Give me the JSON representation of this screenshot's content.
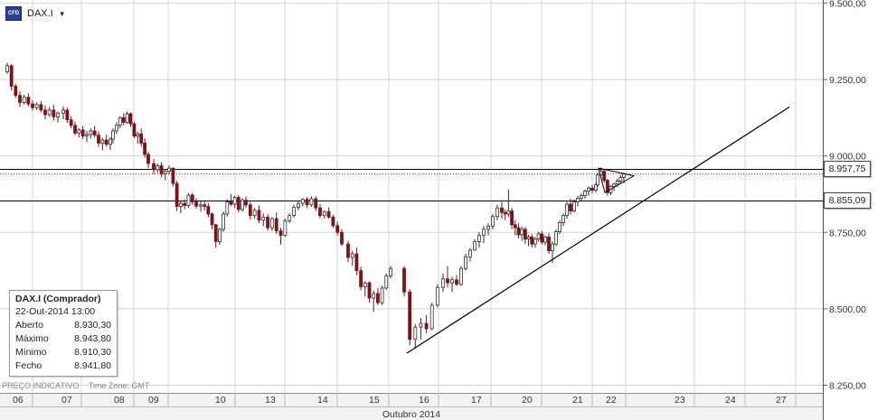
{
  "symbol": {
    "icon": "cfd-icon",
    "icon_text": "CFD",
    "name": "DAX.I"
  },
  "ohlc": {
    "title": "DAX.I (Comprador)",
    "datetime": "22-Out-2014 13:00",
    "rows": [
      {
        "label": "Aberto",
        "value": "8.930,30"
      },
      {
        "label": "Máximo",
        "value": "8.943,80"
      },
      {
        "label": "Mínimo",
        "value": "8.910,30"
      },
      {
        "label": "Fecho",
        "value": "8.941,80"
      }
    ]
  },
  "footer": {
    "price_type": "PREÇO INDICATIVO",
    "timezone": "Time Zone: GMT"
  },
  "colors": {
    "bull": "#2d2d2d",
    "bear": "#7a1418",
    "grid": "#d4d4d4",
    "line": "#000000"
  },
  "chart_data": {
    "type": "candlestick",
    "xlabel": "Outubro 2014",
    "x_ticks": [
      "06",
      "07",
      "08",
      "09",
      "10",
      "13",
      "14",
      "15",
      "16",
      "17",
      "20",
      "21",
      "22",
      "23",
      "24",
      "27"
    ],
    "y_ticks": [
      "9.500,00",
      "9.250,00",
      "9.000,00",
      "8.750,00",
      "8.500,00",
      "8.250,00"
    ],
    "y_tick_values": [
      9500,
      9250,
      9000,
      8750,
      8500,
      8250
    ],
    "ylim": [
      8225,
      9510
    ],
    "grid": true,
    "markers": [
      {
        "label": "8.957,75",
        "value": 8957.75
      },
      {
        "label": "8.855,09",
        "value": 8855.09
      }
    ],
    "horizontal_lines": [
      8957.75,
      8855.09
    ],
    "dotted_line": 8941.8,
    "trendline": {
      "from": [
        "16",
        8355
      ],
      "to": [
        "27",
        9160
      ]
    },
    "triangle": {
      "points": [
        [
          "22",
          8960
        ],
        [
          "22",
          8880
        ],
        [
          "23",
          8935
        ]
      ]
    },
    "sessions": [
      "06",
      "07",
      "08",
      "09",
      "10",
      "13",
      "14",
      "15",
      "16",
      "17",
      "20",
      "21",
      "22"
    ],
    "series": [
      {
        "date": "06",
        "candles": [
          [
            9275,
            9305,
            9268,
            9295
          ],
          [
            9295,
            9300,
            9215,
            9228
          ],
          [
            9228,
            9235,
            9190,
            9198
          ],
          [
            9198,
            9212,
            9160,
            9175
          ],
          [
            9175,
            9200,
            9168,
            9192
          ],
          [
            9192,
            9205,
            9162,
            9170
          ],
          [
            9170,
            9182,
            9148,
            9158
          ],
          [
            9158,
            9175,
            9150,
            9168
          ],
          [
            9168,
            9180,
            9142,
            9150
          ],
          [
            9150,
            9165,
            9120,
            9135
          ],
          [
            9135,
            9160,
            9128,
            9150
          ],
          [
            9150,
            9168,
            9115,
            9128
          ],
          [
            9128,
            9145,
            9110,
            9140
          ]
        ]
      },
      {
        "date": "07",
        "candles": [
          [
            9140,
            9162,
            9120,
            9150
          ],
          [
            9150,
            9158,
            9108,
            9118
          ],
          [
            9118,
            9130,
            9090,
            9100
          ],
          [
            9100,
            9112,
            9068,
            9075
          ],
          [
            9075,
            9090,
            9060,
            9085
          ],
          [
            9085,
            9098,
            9055,
            9065
          ],
          [
            9065,
            9082,
            9045,
            9070
          ],
          [
            9070,
            9090,
            9058,
            9082
          ],
          [
            9082,
            9098,
            9060,
            9068
          ],
          [
            9068,
            9080,
            9030,
            9042
          ],
          [
            9042,
            9060,
            9018,
            9052
          ],
          [
            9052,
            9070,
            9030,
            9038
          ],
          [
            9038,
            9062,
            9020,
            9055
          ]
        ]
      },
      {
        "date": "08",
        "candles": [
          [
            9055,
            9090,
            9040,
            9082
          ],
          [
            9082,
            9110,
            9072,
            9100
          ],
          [
            9100,
            9130,
            9090,
            9125
          ],
          [
            9125,
            9140,
            9100,
            9110
          ],
          [
            9110,
            9145,
            9105,
            9138
          ],
          [
            9138,
            9142,
            9095,
            9105
          ],
          [
            9105,
            9112,
            9058,
            9065
          ],
          [
            9065,
            9080,
            9040,
            9072
          ],
          [
            9072,
            9090,
            9030,
            9042
          ],
          [
            9042,
            9058,
            8995,
            9005
          ],
          [
            9005,
            9015,
            8960,
            8975
          ]
        ]
      },
      {
        "date": "09",
        "candles": [
          [
            8975,
            8990,
            8940,
            8955
          ],
          [
            8955,
            8975,
            8945,
            8968
          ],
          [
            8968,
            8980,
            8930,
            8942
          ],
          [
            8942,
            8958,
            8920,
            8950
          ],
          [
            8950,
            8968,
            8940,
            8960
          ],
          [
            8960,
            8962,
            8900,
            8910
          ],
          [
            8910,
            8918,
            8820,
            8835
          ],
          [
            8835,
            8852,
            8812,
            8845
          ],
          [
            8845,
            8858,
            8826,
            8838
          ],
          [
            8838,
            8878,
            8830,
            8872
          ],
          [
            8872,
            8880,
            8840,
            8850
          ],
          [
            8850,
            8862,
            8828,
            8836
          ]
        ]
      },
      {
        "date": "10",
        "candles": [
          [
            8836,
            8852,
            8818,
            8840
          ],
          [
            8840,
            8855,
            8822,
            8835
          ],
          [
            8835,
            8846,
            8800,
            8810
          ],
          [
            8810,
            8815,
            8760,
            8775
          ],
          [
            8775,
            8778,
            8700,
            8720
          ],
          [
            8720,
            8765,
            8710,
            8760
          ],
          [
            8760,
            8818,
            8752,
            8810
          ],
          [
            8810,
            8858,
            8802,
            8850
          ],
          [
            8850,
            8875,
            8836,
            8842
          ],
          [
            8842,
            8870,
            8830,
            8864
          ],
          [
            8864,
            8872,
            8815,
            8825
          ],
          [
            8825,
            8862,
            8818,
            8855
          ]
        ]
      },
      {
        "date": "13",
        "candles": [
          [
            8855,
            8868,
            8830,
            8840
          ],
          [
            8840,
            8850,
            8792,
            8805
          ],
          [
            8805,
            8830,
            8795,
            8822
          ],
          [
            8822,
            8838,
            8780,
            8790
          ],
          [
            8790,
            8812,
            8770,
            8800
          ],
          [
            8800,
            8810,
            8755,
            8765
          ],
          [
            8765,
            8800,
            8755,
            8795
          ],
          [
            8795,
            8815,
            8745,
            8755
          ],
          [
            8755,
            8765,
            8710,
            8740
          ],
          [
            8740,
            8795,
            8735,
            8788
          ],
          [
            8788,
            8812,
            8780,
            8805
          ],
          [
            8805,
            8840,
            8798,
            8832
          ]
        ]
      },
      {
        "date": "14",
        "candles": [
          [
            8832,
            8852,
            8822,
            8845
          ],
          [
            8845,
            8862,
            8835,
            8858
          ],
          [
            8858,
            8866,
            8830,
            8840
          ],
          [
            8840,
            8868,
            8834,
            8860
          ],
          [
            8860,
            8868,
            8820,
            8830
          ],
          [
            8830,
            8842,
            8796,
            8805
          ],
          [
            8805,
            8822,
            8795,
            8818
          ],
          [
            8818,
            8832,
            8795,
            8800
          ],
          [
            8800,
            8808,
            8765,
            8772
          ],
          [
            8772,
            8785,
            8740,
            8750
          ],
          [
            8750,
            8760,
            8705,
            8712
          ]
        ]
      },
      {
        "date": "15",
        "candles": [
          [
            8712,
            8722,
            8652,
            8668
          ],
          [
            8668,
            8690,
            8640,
            8680
          ],
          [
            8680,
            8700,
            8610,
            8625
          ],
          [
            8625,
            8638,
            8560,
            8572
          ],
          [
            8572,
            8590,
            8540,
            8585
          ],
          [
            8585,
            8590,
            8520,
            8535
          ],
          [
            8535,
            8560,
            8490,
            8550
          ],
          [
            8550,
            8568,
            8512,
            8520
          ],
          [
            8520,
            8575,
            8512,
            8568
          ],
          [
            8568,
            8615,
            8562,
            8608
          ],
          [
            8608,
            8640,
            8600,
            8632
          ]
        ]
      },
      {
        "date": "16",
        "candles": [
          [
            8632,
            8640,
            8540,
            8555
          ],
          [
            8555,
            8565,
            8380,
            8400
          ],
          [
            8400,
            8450,
            8370,
            8440
          ],
          [
            8440,
            8470,
            8400,
            8452
          ],
          [
            8452,
            8480,
            8420,
            8435
          ],
          [
            8435,
            8520,
            8430,
            8512
          ],
          [
            8512,
            8580,
            8505,
            8570
          ],
          [
            8570,
            8615,
            8555,
            8598
          ]
        ]
      },
      {
        "date": "17",
        "candles": [
          [
            8598,
            8640,
            8570,
            8585
          ],
          [
            8585,
            8605,
            8555,
            8595
          ],
          [
            8595,
            8610,
            8575,
            8580
          ],
          [
            8580,
            8640,
            8575,
            8632
          ],
          [
            8632,
            8680,
            8625,
            8670
          ],
          [
            8670,
            8700,
            8655,
            8692
          ],
          [
            8692,
            8728,
            8690,
            8720
          ],
          [
            8720,
            8750,
            8700,
            8740
          ],
          [
            8740,
            8770,
            8715,
            8760
          ],
          [
            8760,
            8780,
            8740,
            8770
          ],
          [
            8770,
            8810,
            8760,
            8802
          ],
          [
            8802,
            8840,
            8790,
            8830
          ]
        ]
      },
      {
        "date": "20",
        "candles": [
          [
            8830,
            8850,
            8795,
            8815
          ],
          [
            8815,
            8825,
            8790,
            8810
          ],
          [
            8810,
            8890,
            8800,
            8820
          ],
          [
            8820,
            8830,
            8760,
            8775
          ],
          [
            8775,
            8790,
            8740,
            8765
          ],
          [
            8765,
            8780,
            8730,
            8742
          ],
          [
            8742,
            8770,
            8722,
            8760
          ],
          [
            8760,
            8768,
            8712,
            8728
          ],
          [
            8728,
            8742,
            8705,
            8735
          ],
          [
            8735,
            8745,
            8700,
            8712
          ],
          [
            8712,
            8735,
            8700,
            8728
          ],
          [
            8728,
            8752,
            8720,
            8745
          ],
          [
            8745,
            8755,
            8710,
            8718
          ],
          [
            8718,
            8740,
            8708,
            8735
          ]
        ]
      },
      {
        "date": "21",
        "candles": [
          [
            8735,
            8748,
            8680,
            8690
          ],
          [
            8690,
            8720,
            8650,
            8712
          ],
          [
            8712,
            8760,
            8705,
            8752
          ],
          [
            8752,
            8790,
            8745,
            8782
          ],
          [
            8782,
            8812,
            8770,
            8805
          ],
          [
            8805,
            8850,
            8795,
            8842
          ],
          [
            8842,
            8860,
            8808,
            8820
          ],
          [
            8820,
            8858,
            8815,
            8850
          ],
          [
            8850,
            8870,
            8835,
            8862
          ],
          [
            8862,
            8878,
            8850,
            8870
          ],
          [
            8870,
            8890,
            8860,
            8885
          ],
          [
            8885,
            8900,
            8870,
            8895
          ],
          [
            8895,
            8905,
            8878,
            8888
          ],
          [
            8888,
            8912,
            8880,
            8905
          ]
        ]
      },
      {
        "date": "22",
        "candles": [
          [
            8905,
            8945,
            8898,
            8938
          ],
          [
            8938,
            8962,
            8925,
            8950
          ],
          [
            8950,
            8955,
            8912,
            8920
          ],
          [
            8920,
            8925,
            8870,
            8880
          ],
          [
            8880,
            8905,
            8872,
            8900
          ],
          [
            8900,
            8912,
            8885,
            8908
          ],
          [
            8908,
            8925,
            8898,
            8918
          ],
          [
            8918,
            8938,
            8910,
            8930
          ],
          [
            8930,
            8944,
            8910,
            8942
          ]
        ]
      }
    ]
  }
}
